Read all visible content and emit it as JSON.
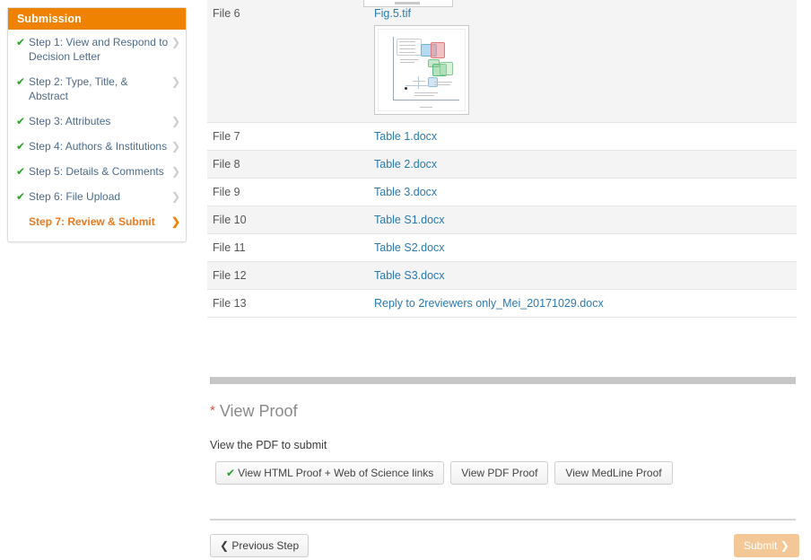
{
  "sidebar": {
    "header": "Submission",
    "steps": [
      {
        "label": "Step 1: View and Respond to Decision Letter",
        "complete": true,
        "active": false,
        "check": "✔",
        "arrow": "❯"
      },
      {
        "label": "Step 2: Type, Title, & Abstract",
        "complete": true,
        "active": false,
        "check": "✔",
        "arrow": "❯"
      },
      {
        "label": "Step 3: Attributes",
        "complete": true,
        "active": false,
        "check": "✔",
        "arrow": "❯"
      },
      {
        "label": "Step 4: Authors & Institutions",
        "complete": true,
        "active": false,
        "check": "✔",
        "arrow": "❯"
      },
      {
        "label": "Step 5: Details & Comments",
        "complete": true,
        "active": false,
        "check": "✔",
        "arrow": "❯"
      },
      {
        "label": "Step 6: File Upload",
        "complete": true,
        "active": false,
        "check": "✔",
        "arrow": "❯"
      },
      {
        "label": "Step 7: Review & Submit",
        "complete": false,
        "active": true,
        "check": "",
        "arrow": "❯"
      }
    ]
  },
  "file_table": {
    "rows": [
      {
        "number": "File 6",
        "name": "Fig.5.tif",
        "has_thumbnail": true,
        "stripe": true
      },
      {
        "number": "File 7",
        "name": "Table 1.docx",
        "has_thumbnail": false,
        "stripe": false
      },
      {
        "number": "File 8",
        "name": "Table 2.docx",
        "has_thumbnail": false,
        "stripe": true
      },
      {
        "number": "File 9",
        "name": "Table 3.docx",
        "has_thumbnail": false,
        "stripe": false
      },
      {
        "number": "File 10",
        "name": "Table S1.docx",
        "has_thumbnail": false,
        "stripe": true
      },
      {
        "number": "File 11",
        "name": "Table S2.docx",
        "has_thumbnail": false,
        "stripe": false
      },
      {
        "number": "File 12",
        "name": "Table S3.docx",
        "has_thumbnail": false,
        "stripe": true
      },
      {
        "number": "File 13",
        "name": "Reply to 2reviewers only_Mei_20171029.docx",
        "has_thumbnail": false,
        "stripe": false
      }
    ]
  },
  "proof": {
    "required_marker": "*",
    "title": "View Proof",
    "subtitle": "View the PDF to submit",
    "buttons": [
      {
        "label": "View HTML Proof + Web of Science links",
        "viewed": true,
        "check": "✔"
      },
      {
        "label": "View PDF Proof",
        "viewed": false,
        "check": ""
      },
      {
        "label": "View MedLine Proof",
        "viewed": false,
        "check": ""
      }
    ]
  },
  "navigation": {
    "previous_label": "Previous Step",
    "previous_icon": "❮",
    "submit_label": "Submit",
    "submit_icon": "❯",
    "submit_disabled": true
  },
  "colors": {
    "accent_orange": "#ef8200",
    "link_blue": "#2a7ab0",
    "check_green": "#2aa02a",
    "required_red": "#d9534f",
    "submit_disabled": "#f3c796"
  }
}
